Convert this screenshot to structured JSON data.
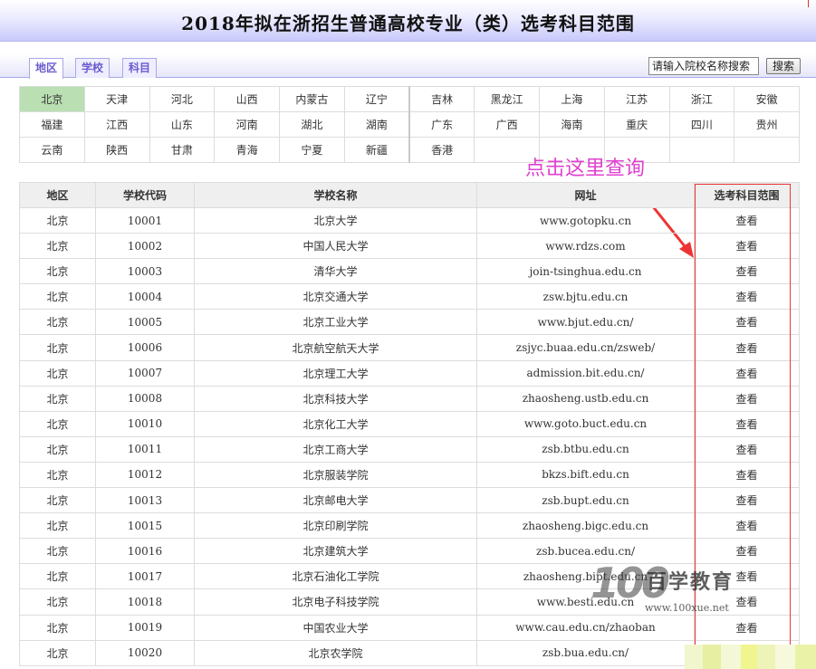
{
  "header": {
    "title": "2018年拟在浙招生普通高校专业（类）选考科目范围"
  },
  "tabs": [
    {
      "label": "地区",
      "active": true
    },
    {
      "label": "学校",
      "active": false
    },
    {
      "label": "科目",
      "active": false
    }
  ],
  "search": {
    "placeholder": "请输入院校名称搜索",
    "button_label": "搜索"
  },
  "regions": {
    "rows": [
      [
        "北京",
        "天津",
        "河北",
        "山西",
        "内蒙古",
        "辽宁",
        "吉林",
        "黑龙江",
        "上海",
        "江苏",
        "浙江",
        "安徽"
      ],
      [
        "福建",
        "江西",
        "山东",
        "河南",
        "湖北",
        "湖南",
        "广东",
        "广西",
        "海南",
        "重庆",
        "四川",
        "贵州"
      ],
      [
        "云南",
        "陕西",
        "甘肃",
        "青海",
        "宁夏",
        "新疆",
        "香港",
        "",
        "",
        "",
        "",
        ""
      ]
    ],
    "selected": "北京"
  },
  "annotation": {
    "text": "点击这里查询"
  },
  "table": {
    "headers": [
      "地区",
      "学校代码",
      "学校名称",
      "网址",
      "选考科目范围"
    ],
    "rows": [
      [
        "北京",
        "10001",
        "北京大学",
        "www.gotopku.cn",
        "查看"
      ],
      [
        "北京",
        "10002",
        "中国人民大学",
        "www.rdzs.com",
        "查看"
      ],
      [
        "北京",
        "10003",
        "清华大学",
        "join-tsinghua.edu.cn",
        "查看"
      ],
      [
        "北京",
        "10004",
        "北京交通大学",
        "zsw.bjtu.edu.cn",
        "查看"
      ],
      [
        "北京",
        "10005",
        "北京工业大学",
        "www.bjut.edu.cn/",
        "查看"
      ],
      [
        "北京",
        "10006",
        "北京航空航天大学",
        "zsjyc.buaa.edu.cn/zsweb/",
        "查看"
      ],
      [
        "北京",
        "10007",
        "北京理工大学",
        "admission.bit.edu.cn/",
        "查看"
      ],
      [
        "北京",
        "10008",
        "北京科技大学",
        "zhaosheng.ustb.edu.cn",
        "查看"
      ],
      [
        "北京",
        "10010",
        "北京化工大学",
        "www.goto.buct.edu.cn",
        "查看"
      ],
      [
        "北京",
        "10011",
        "北京工商大学",
        "zsb.btbu.edu.cn",
        "查看"
      ],
      [
        "北京",
        "10012",
        "北京服装学院",
        "bkzs.bift.edu.cn",
        "查看"
      ],
      [
        "北京",
        "10013",
        "北京邮电大学",
        "zsb.bupt.edu.cn",
        "查看"
      ],
      [
        "北京",
        "10015",
        "北京印刷学院",
        "zhaosheng.bigc.edu.cn",
        "查看"
      ],
      [
        "北京",
        "10016",
        "北京建筑大学",
        "zsb.bucea.edu.cn/",
        "查看"
      ],
      [
        "北京",
        "10017",
        "北京石油化工学院",
        "zhaosheng.bipt.edu.cn",
        "查看"
      ],
      [
        "北京",
        "10018",
        "北京电子科技学院",
        "www.besti.edu.cn",
        "查看"
      ],
      [
        "北京",
        "10019",
        "中国农业大学",
        "www.cau.edu.cn/zhaoban",
        "查看"
      ],
      [
        "北京",
        "10020",
        "北京农学院",
        "zsb.bua.edu.cn/",
        "查看"
      ]
    ]
  },
  "watermark": {
    "logo": "100",
    "name": "百学教育",
    "url": "www.100xue.net"
  },
  "colors": {
    "title_gradient_end": "#c9c9fb",
    "tab_text": "#6a5acd",
    "selected_region": "#b9dfb2",
    "annotation": "#e040d0",
    "highlight_box": "#e33333",
    "header_row_bg": "#efefef"
  }
}
